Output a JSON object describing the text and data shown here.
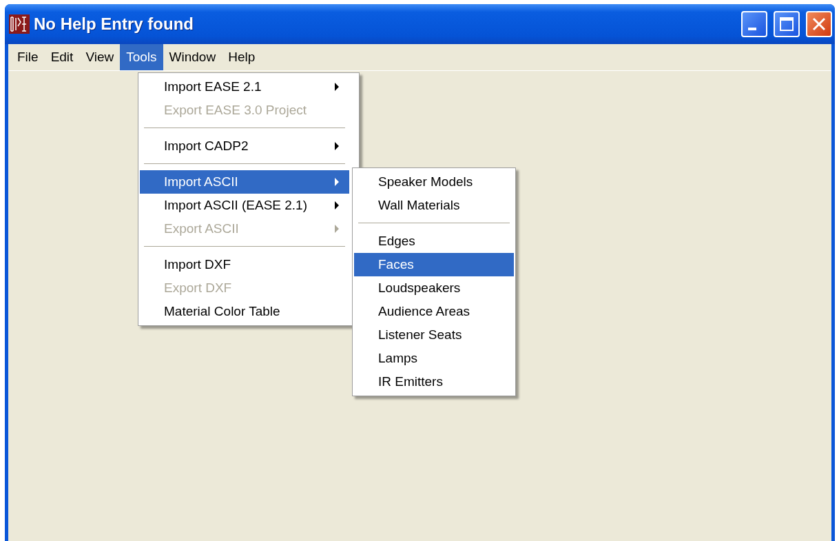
{
  "window": {
    "title": "No Help Entry found"
  },
  "menubar": [
    {
      "label": "File",
      "selected": false
    },
    {
      "label": "Edit",
      "selected": false
    },
    {
      "label": "View",
      "selected": false
    },
    {
      "label": "Tools",
      "selected": true
    },
    {
      "label": "Window",
      "selected": false
    },
    {
      "label": "Help",
      "selected": false
    }
  ],
  "tools_menu": [
    {
      "kind": "item",
      "label": "Import EASE 2.1",
      "disabled": false,
      "submenu": true,
      "selected": false
    },
    {
      "kind": "item",
      "label": "Export EASE 3.0 Project",
      "disabled": true,
      "submenu": false,
      "selected": false
    },
    {
      "kind": "separator"
    },
    {
      "kind": "item",
      "label": "Import CADP2",
      "disabled": false,
      "submenu": true,
      "selected": false
    },
    {
      "kind": "separator"
    },
    {
      "kind": "item",
      "label": "Import ASCII",
      "disabled": false,
      "submenu": true,
      "selected": true
    },
    {
      "kind": "item",
      "label": "Import ASCII (EASE 2.1)",
      "disabled": false,
      "submenu": true,
      "selected": false
    },
    {
      "kind": "item",
      "label": "Export ASCII",
      "disabled": true,
      "submenu": true,
      "selected": false
    },
    {
      "kind": "separator"
    },
    {
      "kind": "item",
      "label": "Import DXF",
      "disabled": false,
      "submenu": false,
      "selected": false
    },
    {
      "kind": "item",
      "label": "Export DXF",
      "disabled": true,
      "submenu": false,
      "selected": false
    },
    {
      "kind": "item",
      "label": "Material Color Table",
      "disabled": false,
      "submenu": false,
      "selected": false
    }
  ],
  "import_ascii_submenu": [
    {
      "kind": "item",
      "label": "Speaker Models",
      "disabled": false,
      "submenu": false,
      "selected": false
    },
    {
      "kind": "item",
      "label": "Wall Materials",
      "disabled": false,
      "submenu": false,
      "selected": false
    },
    {
      "kind": "separator"
    },
    {
      "kind": "item",
      "label": "Edges",
      "disabled": false,
      "submenu": false,
      "selected": false
    },
    {
      "kind": "item",
      "label": "Faces",
      "disabled": false,
      "submenu": false,
      "selected": true
    },
    {
      "kind": "item",
      "label": "Loudspeakers",
      "disabled": false,
      "submenu": false,
      "selected": false
    },
    {
      "kind": "item",
      "label": "Audience Areas",
      "disabled": false,
      "submenu": false,
      "selected": false
    },
    {
      "kind": "item",
      "label": "Listener Seats",
      "disabled": false,
      "submenu": false,
      "selected": false
    },
    {
      "kind": "item",
      "label": "Lamps",
      "disabled": false,
      "submenu": false,
      "selected": false
    },
    {
      "kind": "item",
      "label": "IR Emitters",
      "disabled": false,
      "submenu": false,
      "selected": false
    }
  ]
}
